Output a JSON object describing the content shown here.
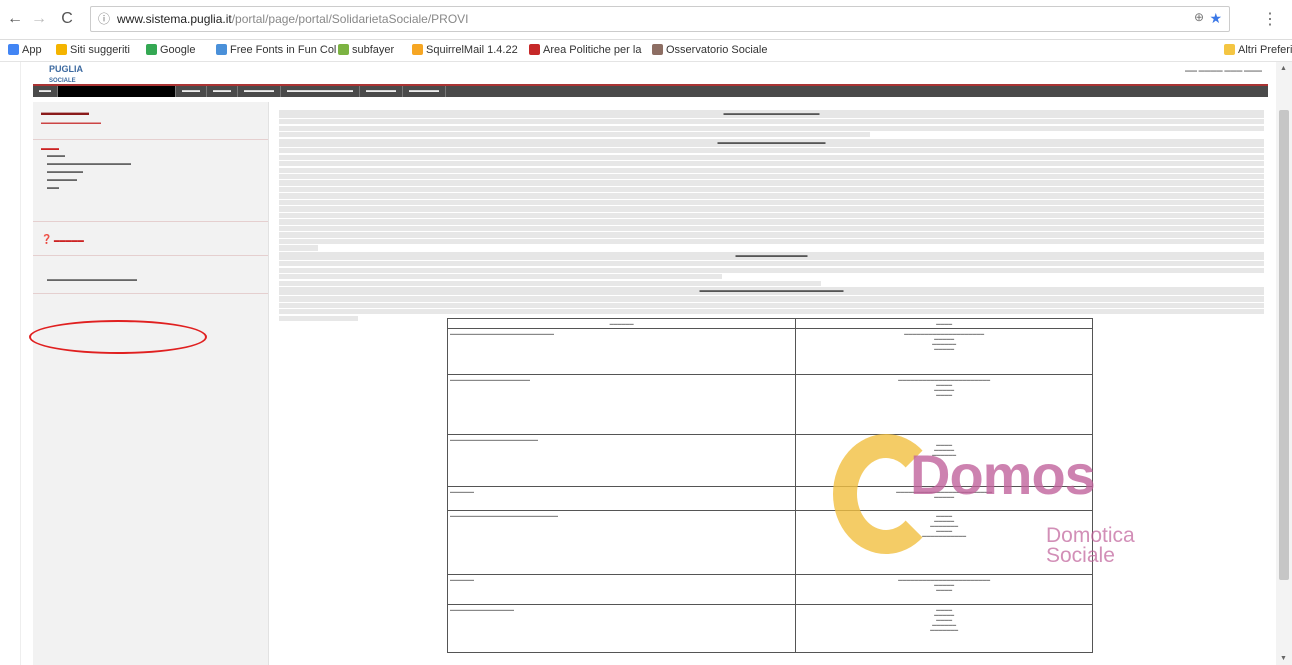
{
  "browser": {
    "url_host": "www.sistema.puglia.it",
    "url_path": "/portal/page/portal/SolidarietaSociale/PROVI",
    "bookmarks": [
      {
        "label": "App",
        "color": "#4285f4"
      },
      {
        "label": "Siti suggeriti",
        "color": "#f4b400"
      },
      {
        "label": "Google",
        "color": "#34a853"
      },
      {
        "label": "Free Fonts in Fun Col",
        "color": "#4a90d9"
      },
      {
        "label": "subfayer",
        "color": "#7cb342"
      },
      {
        "label": "SquirrelMail 1.4.22",
        "color": "#f6a623"
      },
      {
        "label": "Area Politiche per la",
        "color": "#c62828"
      },
      {
        "label": "Osservatorio Sociale",
        "color": "#8d6e63"
      }
    ],
    "other_bookmarks": "Altri Preferiti"
  },
  "site": {
    "logo": "PUGLIA",
    "logo_sub": "SOCIALE"
  },
  "watermark": {
    "brand": "Domos",
    "tagline_1": "Domotica",
    "tagline_2": "Sociale"
  },
  "accent": "#e02020"
}
